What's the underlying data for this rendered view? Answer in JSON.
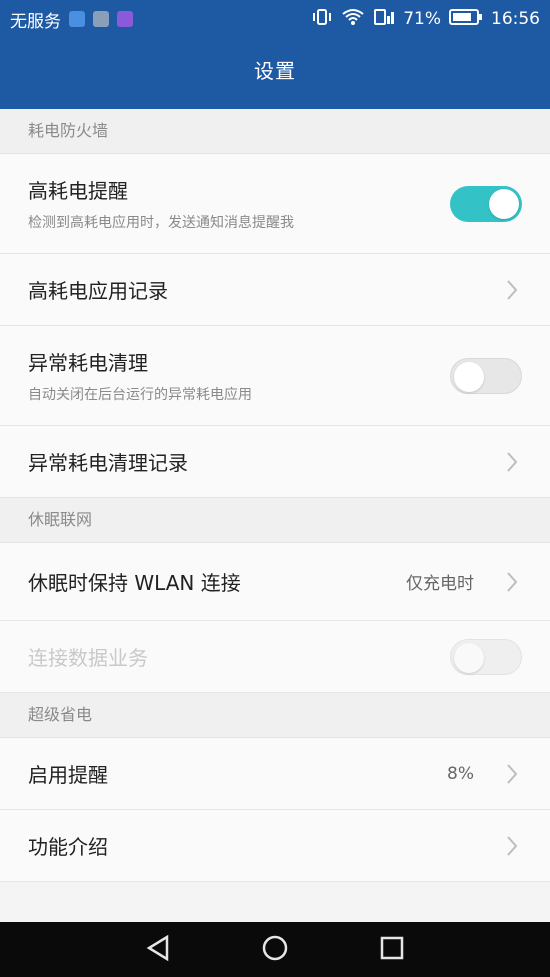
{
  "statusbar": {
    "carrier": "无服务",
    "battery_percent": "71%",
    "time": "16:56"
  },
  "header": {
    "title": "设置"
  },
  "sections": {
    "firewall": {
      "label": "耗电防火墙"
    },
    "sleep": {
      "label": "休眠联网"
    },
    "super_saver": {
      "label": "超级省电"
    }
  },
  "rows": {
    "high_power_alert": {
      "title": "高耗电提醒",
      "subtitle": "检测到高耗电应用时，发送通知消息提醒我",
      "toggle": "on"
    },
    "high_power_record": {
      "title": "高耗电应用记录"
    },
    "abnormal_cleanup": {
      "title": "异常耗电清理",
      "subtitle": "自动关闭在后台运行的异常耗电应用",
      "toggle": "off"
    },
    "abnormal_cleanup_record": {
      "title": "异常耗电清理记录"
    },
    "keep_wlan": {
      "title": "休眠时保持 WLAN 连接",
      "value": "仅充电时"
    },
    "data_service": {
      "title": "连接数据业务",
      "toggle": "off",
      "disabled": true
    },
    "enable_alert": {
      "title": "启用提醒",
      "value": "8%"
    },
    "feature_intro": {
      "title": "功能介绍"
    }
  },
  "colors": {
    "appbar": "#1e5aa3",
    "toggle_on": "#33c2c5",
    "navbar": "#0a0a0a"
  },
  "icons": {
    "chevron": "chevron-right-icon",
    "nav_back": "back-triangle-icon",
    "nav_home": "home-circle-icon",
    "nav_recents": "recents-square-icon"
  }
}
